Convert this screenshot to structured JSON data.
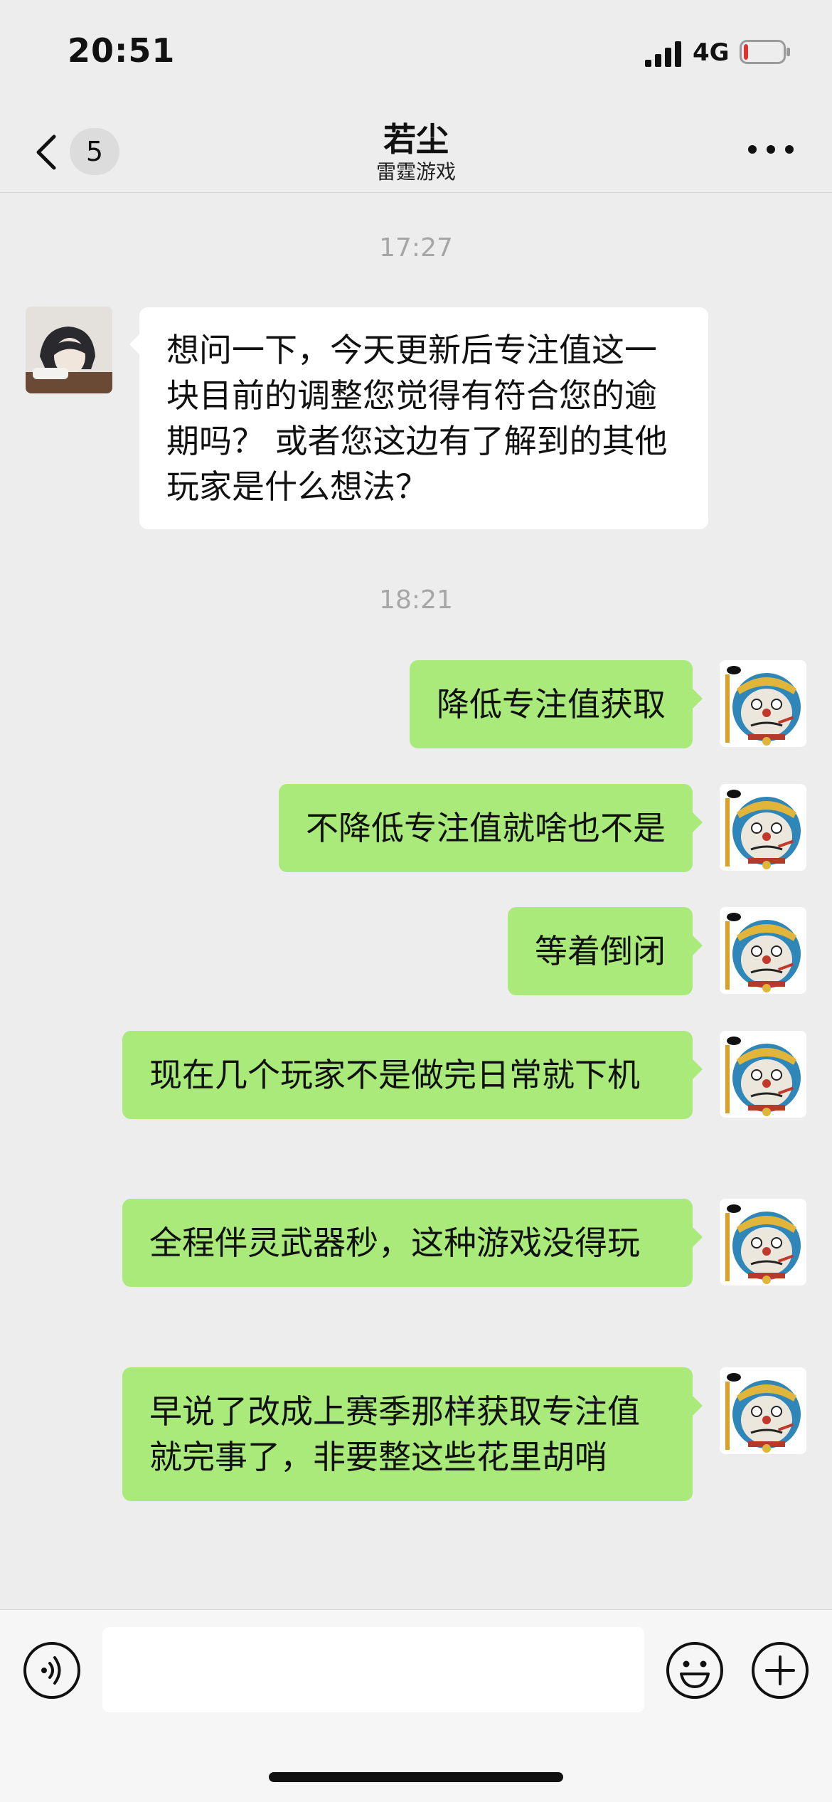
{
  "status_bar": {
    "time": "20:51",
    "network": "4G",
    "battery_level": 0.1,
    "battery_color": "#e0332f"
  },
  "nav": {
    "unread_count": "5",
    "title": "若尘",
    "subtitle": "雷霆游戏"
  },
  "messages": [
    {
      "type": "time",
      "text": "17:27"
    },
    {
      "type": "in",
      "text": "想问一下，今天更新后专注值这一块目前的调整您觉得有符合您的逾期吗？ 或者您这边有了解到的其他玩家是什么想法？"
    },
    {
      "type": "time",
      "text": "18:21"
    },
    {
      "type": "out",
      "text": "降低专注值获取"
    },
    {
      "type": "out",
      "text": "不降低专注值就啥也不是"
    },
    {
      "type": "out",
      "text": "等着倒闭"
    },
    {
      "type": "out",
      "text": "现在几个玩家不是做完日常就下机"
    },
    {
      "type": "out",
      "text": "全程伴灵武器秒，这种游戏没得玩"
    },
    {
      "type": "out",
      "text": "早说了改成上赛季那样获取专注值就完事了，非要整这些花里胡哨"
    }
  ],
  "input": {
    "value": "",
    "placeholder": ""
  },
  "colors": {
    "background": "#ededed",
    "outgoing_bubble": "#a9ea7a",
    "incoming_bubble": "#ffffff",
    "timestamp": "#a6a6a6"
  }
}
